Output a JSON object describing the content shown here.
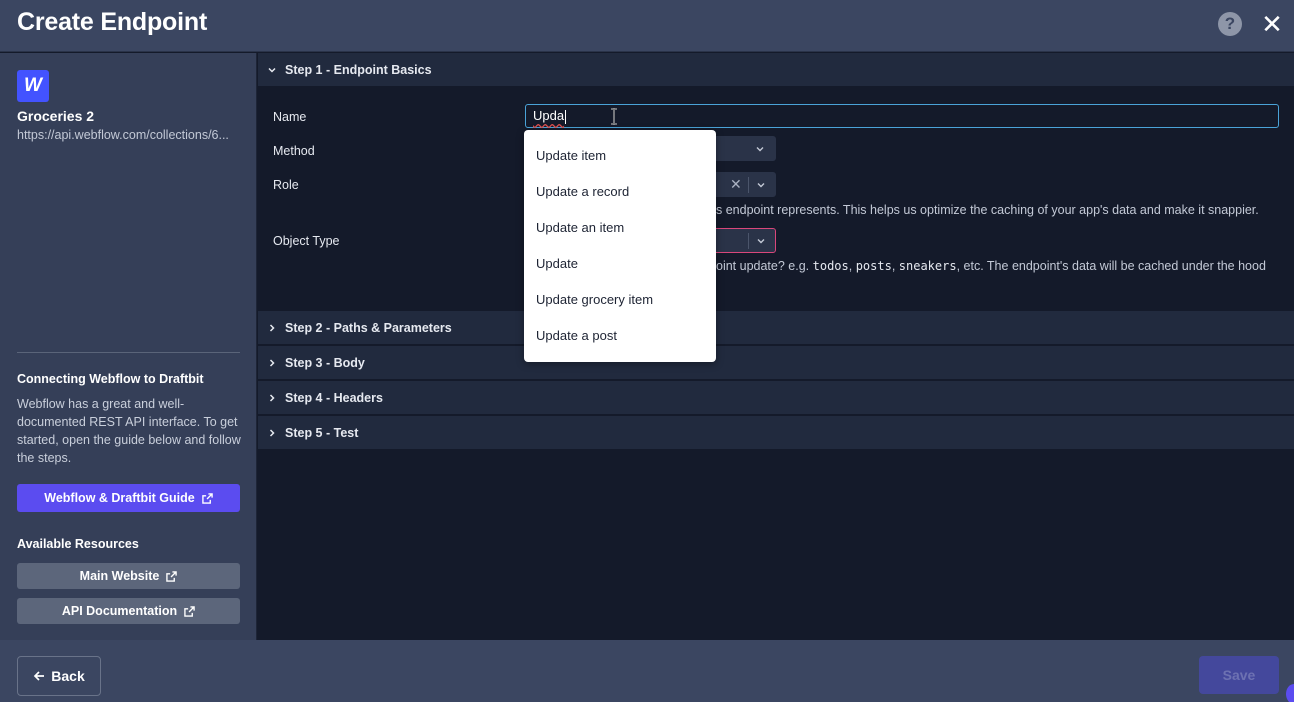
{
  "header": {
    "title": "Create Endpoint",
    "help_label": "?",
    "close_label": "✕"
  },
  "sidebar": {
    "collection_name": "Groceries 2",
    "collection_url": "https://api.webflow.com/collections/6...",
    "logo_letter": "W",
    "guide_title": "Connecting Webflow to Draftbit",
    "guide_text": "Webflow has a great and well-documented REST API interface. To get started, open the guide below and follow the steps.",
    "guide_button": "Webflow & Draftbit Guide",
    "resources_title": "Available Resources",
    "resources": [
      {
        "label": "Main Website"
      },
      {
        "label": "API Documentation"
      }
    ]
  },
  "steps": [
    {
      "label": "Step 1 - Endpoint Basics",
      "expanded": true
    },
    {
      "label": "Step 2 - Paths & Parameters",
      "expanded": false
    },
    {
      "label": "Step 3 - Body",
      "expanded": false
    },
    {
      "label": "Step 4 - Headers",
      "expanded": false
    },
    {
      "label": "Step 5 - Test",
      "expanded": false
    }
  ],
  "form": {
    "name_label": "Name",
    "name_value": "Upda",
    "method_label": "Method",
    "role_label": "Role",
    "role_help": "s endpoint represents. This helps us optimize the caching of your app's data and make it snappier.",
    "object_type_label": "Object Type",
    "object_help_prefix": "oint update? e.g.",
    "object_help_examples": [
      "todos",
      "posts",
      "sneakers"
    ],
    "object_help_suffix": "etc. The endpoint's data will be cached under the hood"
  },
  "name_suggestions": [
    "Update item",
    "Update a record",
    "Update an item",
    "Update",
    "Update grocery item",
    "Update a post"
  ],
  "footer": {
    "back_label": "Back",
    "save_label": "Save"
  },
  "colors": {
    "accent": "#5b4cf0",
    "focus": "#4aa3d8",
    "error": "#d9477b",
    "brand_webflow": "#4353ff"
  }
}
